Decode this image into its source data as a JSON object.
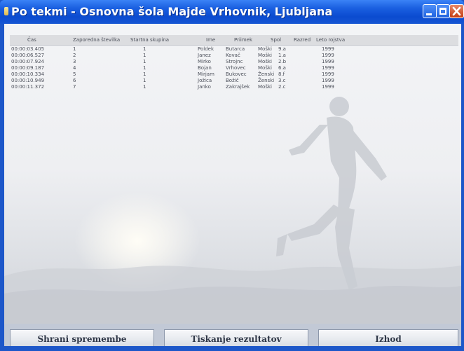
{
  "window": {
    "title": "Po tekmi - Osnovna šola Majde Vrhovnik, Ljubljana"
  },
  "table": {
    "headers": [
      "Čas",
      "Zaporedna številka",
      "Startna skupina",
      "Ime",
      "Priimek",
      "Spol",
      "Razred",
      "Leto rojstva"
    ],
    "rows": [
      [
        "00:00:03.405",
        "1",
        "1",
        "Poldek",
        "Butarca",
        "Moški",
        "9.a",
        "1999"
      ],
      [
        "00:00:06.527",
        "2",
        "1",
        "Janez",
        "Kovač",
        "Moški",
        "1.a",
        "1999"
      ],
      [
        "00:00:07.924",
        "3",
        "1",
        "Mirko",
        "Strojnc",
        "Moški",
        "2.b",
        "1999"
      ],
      [
        "00:00:09.187",
        "4",
        "1",
        "Bojan",
        "Vrhovec",
        "Moški",
        "6.a",
        "1999"
      ],
      [
        "00:00:10.334",
        "5",
        "1",
        "Mirjam",
        "Bukovec",
        "Ženski",
        "8.f",
        "1999"
      ],
      [
        "00:00:10.949",
        "6",
        "1",
        "Jožica",
        "Božič",
        "Ženski",
        "3.c",
        "1999"
      ],
      [
        "00:00:11.372",
        "7",
        "1",
        "Janko",
        "Zakrajšek",
        "Moški",
        "2.c",
        "1999"
      ]
    ]
  },
  "buttons": {
    "save": "Shrani spremembe",
    "print": "Tiskanje rezultatov",
    "exit": "Izhod"
  },
  "icons": {
    "app": "app-icon",
    "minimize": "minimize-icon",
    "maximize": "maximize-icon",
    "close": "close-icon"
  },
  "colors": {
    "titlebar": "#1a5fe0",
    "close_button": "#c43c12",
    "table_header": "#dcdde0"
  }
}
